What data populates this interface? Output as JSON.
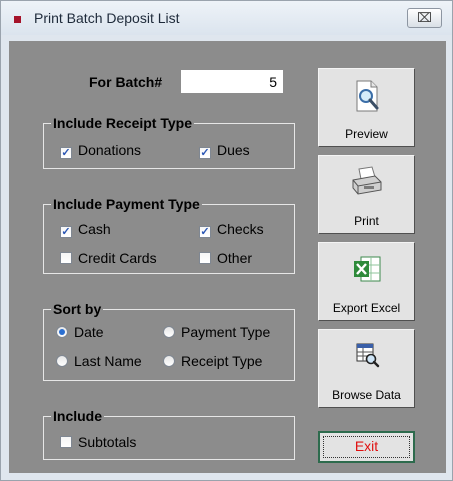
{
  "window": {
    "title": "Print Batch Deposit List",
    "close_glyph": "⌧"
  },
  "batch": {
    "label": "For Batch#",
    "value": "5"
  },
  "receipt_type": {
    "title": "Include Receipt Type",
    "options": [
      {
        "label": "Donations",
        "checked": true
      },
      {
        "label": "Dues",
        "checked": true
      }
    ]
  },
  "payment_type": {
    "title": "Include Payment Type",
    "options": [
      {
        "label": "Cash",
        "checked": true
      },
      {
        "label": "Checks",
        "checked": true
      },
      {
        "label": "Credit Cards",
        "checked": false
      },
      {
        "label": "Other",
        "checked": false
      }
    ]
  },
  "sort_by": {
    "title": "Sort by",
    "options": [
      {
        "label": "Date",
        "selected": true
      },
      {
        "label": "Payment Type",
        "selected": false
      },
      {
        "label": "Last Name",
        "selected": false
      },
      {
        "label": "Receipt Type",
        "selected": false
      }
    ]
  },
  "include": {
    "title": "Include",
    "options": [
      {
        "label": "Subtotals",
        "checked": false
      }
    ]
  },
  "buttons": {
    "preview": "Preview",
    "print": "Print",
    "export_excel": "Export Excel",
    "browse_data": "Browse Data",
    "exit": "Exit"
  },
  "colors": {
    "panel": "#8c8c8c",
    "exit_text": "#e01010",
    "accent": "#a5132a"
  }
}
